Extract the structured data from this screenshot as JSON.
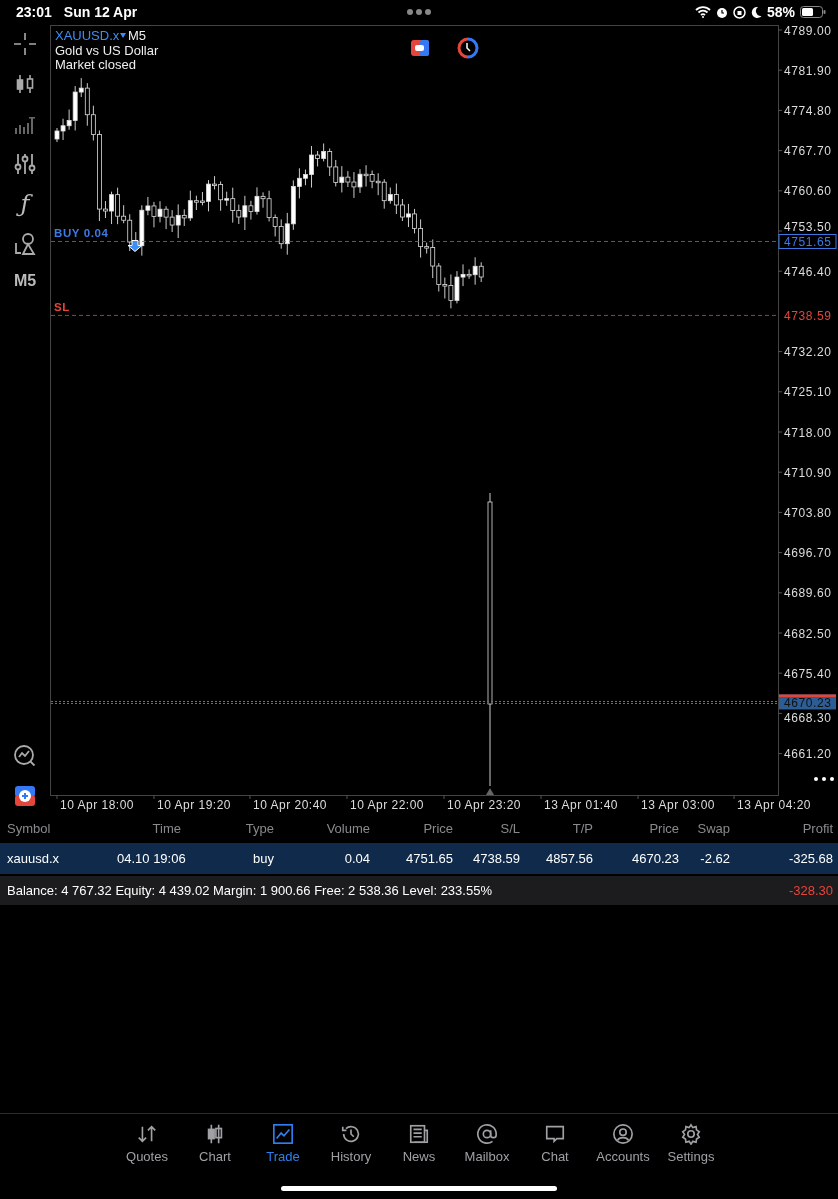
{
  "status_bar": {
    "time": "23:01",
    "date": "Sun 12 Apr",
    "battery": "58%"
  },
  "left_toolbar": {
    "function_glyph": "ƒ",
    "timeframe": "M5"
  },
  "chart": {
    "symbol": "XAUUSD.x",
    "timeframe": "M5",
    "description": "Gold vs US Dollar",
    "market_status": "Market closed",
    "price_labels": [
      "4789.00",
      "4781.90",
      "4774.80",
      "4767.70",
      "4760.60",
      "4753.50",
      "4746.40",
      "4732.20",
      "4725.10",
      "4718.00",
      "4710.90",
      "4703.80",
      "4696.70",
      "4689.60",
      "4682.50",
      "4675.40",
      "4668.30",
      "4661.20"
    ],
    "time_labels": [
      "10 Apr 18:00",
      "10 Apr 19:20",
      "10 Apr 20:40",
      "10 Apr 22:00",
      "10 Apr 23:20",
      "13 Apr 01:40",
      "13 Apr 03:00",
      "13 Apr 04:20"
    ],
    "order_lines": [
      {
        "kind": "buy",
        "label": "BUY 0.04",
        "price": "4751.65"
      },
      {
        "kind": "sl",
        "label": "SL",
        "price": "4738.59"
      }
    ],
    "last_price": "4670.23"
  },
  "table": {
    "columns": [
      "Symbol",
      "Time",
      "Type",
      "Volume",
      "Price",
      "S/L",
      "T/P",
      "Price",
      "Swap",
      "Profit"
    ],
    "rows": [
      {
        "selected": true,
        "cells": [
          "xauusd.x",
          "04.10 19:06",
          "buy",
          "0.04",
          "4751.65",
          "4738.59",
          "4857.56",
          "4670.23",
          "-2.62",
          "-325.68"
        ]
      }
    ],
    "summary": "Balance: 4 767.32 Equity: 4 439.02 Margin: 1 900.66 Free: 2 538.36 Level: 233.55%",
    "total": "-328.30"
  },
  "tabs": [
    {
      "label": "Quotes",
      "selected": false
    },
    {
      "label": "Chart",
      "selected": false
    },
    {
      "label": "Trade",
      "selected": true
    },
    {
      "label": "History",
      "selected": false
    },
    {
      "label": "News",
      "selected": false
    },
    {
      "label": "Mailbox",
      "selected": false
    },
    {
      "label": "Chat",
      "selected": false
    },
    {
      "label": "Accounts",
      "selected": false
    },
    {
      "label": "Settings",
      "selected": false
    }
  ]
}
